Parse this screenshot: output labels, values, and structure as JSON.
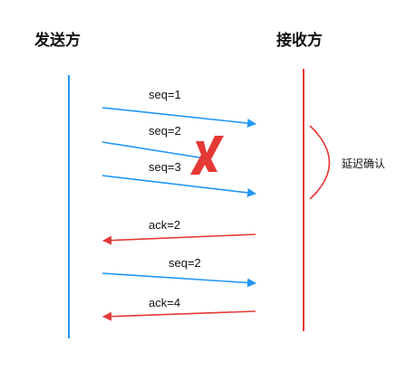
{
  "headers": {
    "sender": "发送方",
    "receiver": "接收方"
  },
  "colors": {
    "sender_line": "#2196f3",
    "receiver_line": "#e53935",
    "data_arrow": "#2196f3",
    "ack_arrow": "#e53935",
    "lost_mark": "#e53935"
  },
  "messages": [
    {
      "label": "seq=1",
      "direction": "to-receiver"
    },
    {
      "label": "seq=2",
      "direction": "to-receiver",
      "lost": true
    },
    {
      "label": "seq=3",
      "direction": "to-receiver"
    },
    {
      "label": "ack=2",
      "direction": "to-sender"
    },
    {
      "label": "seq=2",
      "direction": "to-receiver"
    },
    {
      "label": "ack=4",
      "direction": "to-sender"
    }
  ],
  "delay_label": "延迟确认"
}
